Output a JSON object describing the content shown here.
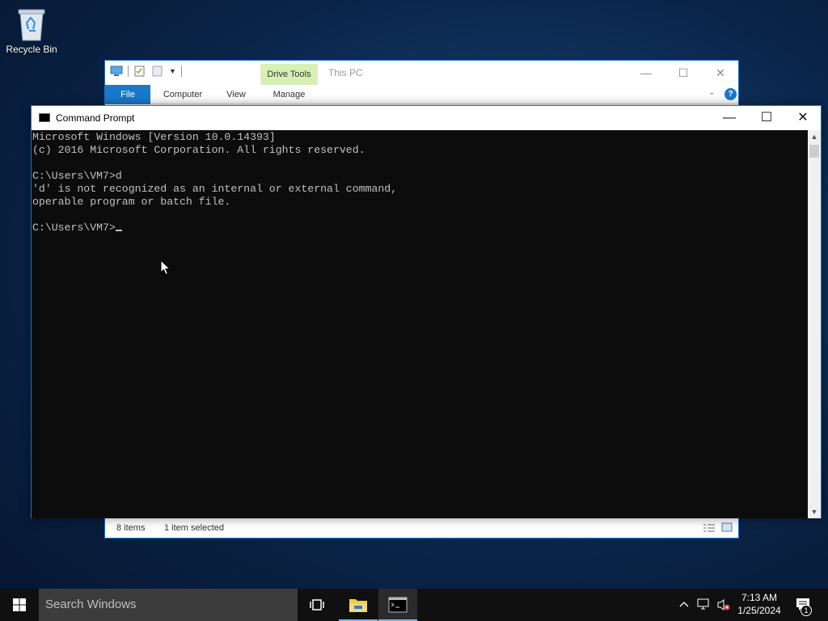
{
  "desktop": {
    "icons": [
      {
        "label": "Recycle Bin",
        "icon": "recycle-bin-icon"
      }
    ]
  },
  "explorer": {
    "title": "This PC",
    "contextual_tab_group": "Drive Tools",
    "tabs": [
      "File",
      "Computer",
      "View",
      "Manage"
    ],
    "status_items": "8 items",
    "status_selected": "1 item selected"
  },
  "cmd": {
    "title": "Command Prompt",
    "lines": [
      "Microsoft Windows [Version 10.0.14393]",
      "(c) 2016 Microsoft Corporation. All rights reserved.",
      "",
      "C:\\Users\\VM7>d",
      "'d' is not recognized as an internal or external command,",
      "operable program or batch file.",
      "",
      "C:\\Users\\VM7>"
    ]
  },
  "taskbar": {
    "search_placeholder": "Search Windows",
    "time": "7:13 AM",
    "date": "1/25/2024",
    "notification_count": "1"
  },
  "colors": {
    "accent": "#1979ca",
    "console_bg": "#0c0c0c",
    "console_text": "#c0c0c0",
    "taskbar": "#101010",
    "drive_tools": "#d8f0b5"
  }
}
